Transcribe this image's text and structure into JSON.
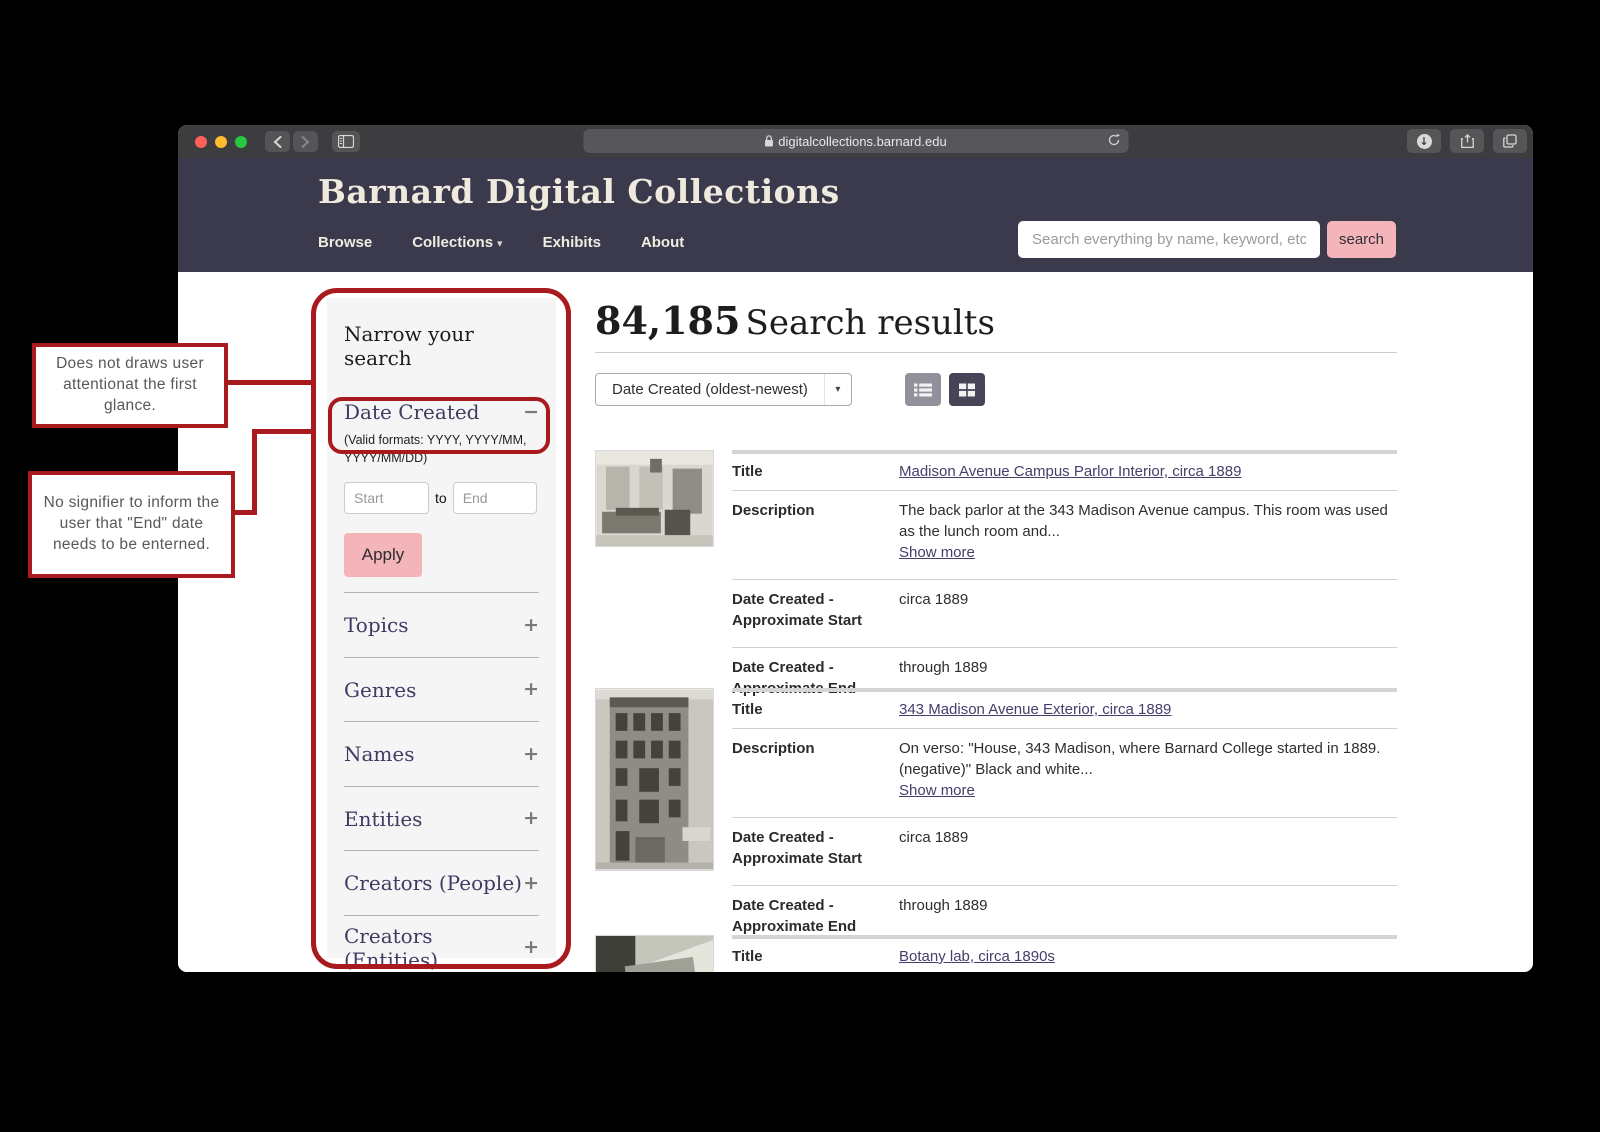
{
  "browser": {
    "url": "digitalcollections.barnard.edu"
  },
  "icons": {
    "nav_caret": "▾",
    "sort_caret": "▾",
    "collapse": "−",
    "expand": "+",
    "download_arrow": "↓"
  },
  "header": {
    "site_title": "Barnard Digital Collections",
    "nav": [
      {
        "label": "Browse"
      },
      {
        "label": "Collections"
      },
      {
        "label": "Exhibits"
      },
      {
        "label": "About"
      }
    ],
    "search": {
      "placeholder": "Search everything by name, keyword, etc",
      "button_label": "search"
    }
  },
  "sidebar": {
    "title": "Narrow your search",
    "date_created": {
      "label": "Date Created",
      "hint": "(Valid formats: YYYY, YYYY/MM, YYYY/MM/DD)",
      "start_placeholder": "Start",
      "to_label": "to",
      "end_placeholder": "End",
      "apply_label": "Apply"
    },
    "facets": [
      {
        "label": "Topics"
      },
      {
        "label": "Genres"
      },
      {
        "label": "Names"
      },
      {
        "label": "Entities"
      },
      {
        "label": "Creators (People)"
      },
      {
        "label": "Creators (Entities)"
      }
    ]
  },
  "results": {
    "count": "84,185",
    "heading": "Search results",
    "sort_selected": "Date Created (oldest-newest)",
    "labels": {
      "title": "Title",
      "description": "Description",
      "start": "Date Created - Approximate Start",
      "end": "Date Created - Approximate End",
      "show_more": "Show more"
    },
    "items": [
      {
        "title": "Madison Avenue Campus Parlor Interior, circa 1889",
        "description": "The back parlor at the 343 Madison Avenue campus. This room was used as the lunch room and...",
        "start": "circa 1889",
        "end": "through 1889"
      },
      {
        "title": "343 Madison Avenue Exterior, circa 1889",
        "description": "On verso: \"House, 343 Madison, where Barnard College started in 1889. (negative)\" Black and white...",
        "start": "circa 1889",
        "end": "through 1889"
      },
      {
        "title": "Botany lab, circa 1890s"
      }
    ]
  },
  "annotations": {
    "callout1": "Does not draws user attentionat the first glance.",
    "callout2": "No signifier to inform the user that \"End\" date needs to be enterned."
  },
  "colors": {
    "header_bg": "#3b3a4c",
    "accent_pink": "#f4b5ba",
    "annotation_red": "#a81a1d",
    "link_navy": "#43406b",
    "facet_navy": "#3e3b63",
    "sidebar_bg": "#f5f5f5"
  }
}
